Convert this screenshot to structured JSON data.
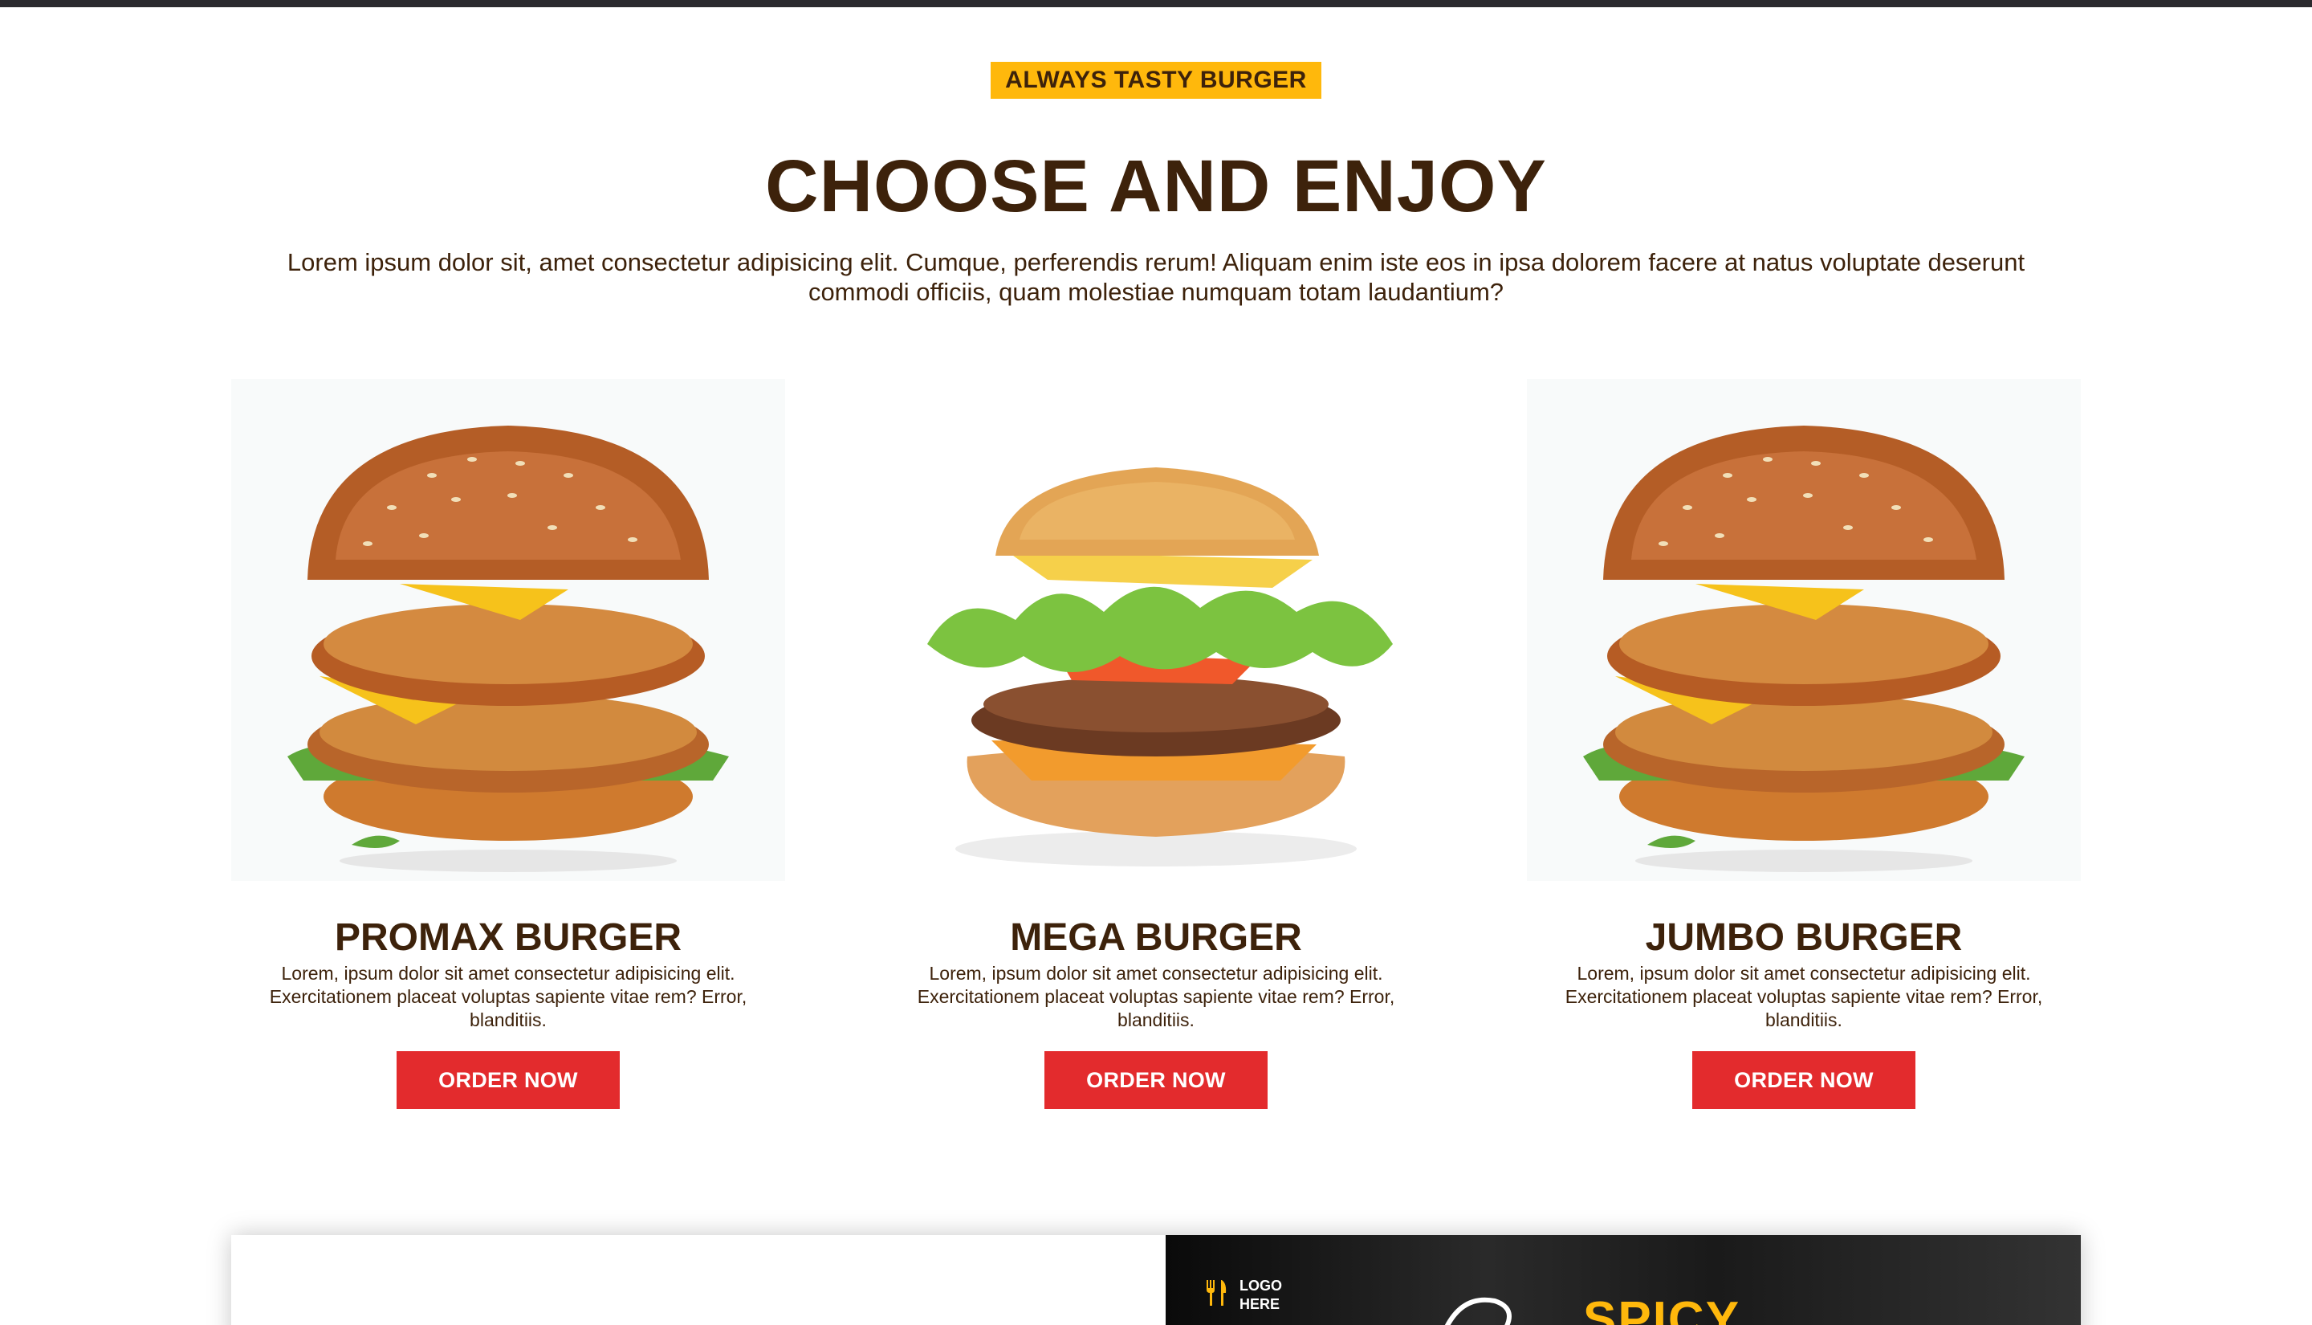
{
  "section": {
    "tag": "ALWAYS TASTY BURGER",
    "title": "CHOOSE AND ENJOY",
    "lead": "Lorem ipsum dolor sit, amet consectetur adipisicing elit. Cumque, perferendis rerum! Aliquam enim iste eos in ipsa dolorem facere at natus voluptate deserunt commodi officiis, quam molestiae numquam totam laudantium?"
  },
  "products": [
    {
      "name": "PROMAX BURGER",
      "description": "Lorem, ipsum dolor sit amet consectetur adipisicing elit. Exercitationem placeat voluptas sapiente vitae rem? Error, blanditiis.",
      "button": "ORDER NOW",
      "image": "crispy-chicken-burger-image"
    },
    {
      "name": "MEGA BURGER",
      "description": "Lorem, ipsum dolor sit amet consectetur adipisicing elit. Exercitationem placeat voluptas sapiente vitae rem? Error, blanditiis.",
      "button": "ORDER NOW",
      "image": "beef-lettuce-burger-image"
    },
    {
      "name": "JUMBO BURGER",
      "description": "Lorem, ipsum dolor sit amet consectetur adipisicing elit. Exercitationem placeat voluptas sapiente vitae rem? Error, blanditiis.",
      "button": "ORDER NOW",
      "image": "crispy-chicken-burger-image"
    }
  ],
  "banner": {
    "logo_line1": "LOGO",
    "logo_line2": "HERE",
    "headline": "SPICY"
  },
  "colors": {
    "accent_yellow": "#ffb80c",
    "heading_brown": "#3d220b",
    "button_red": "#e32b2d",
    "top_bar": "#2b2a2e"
  },
  "icons": [
    "fork-knife-icon"
  ]
}
